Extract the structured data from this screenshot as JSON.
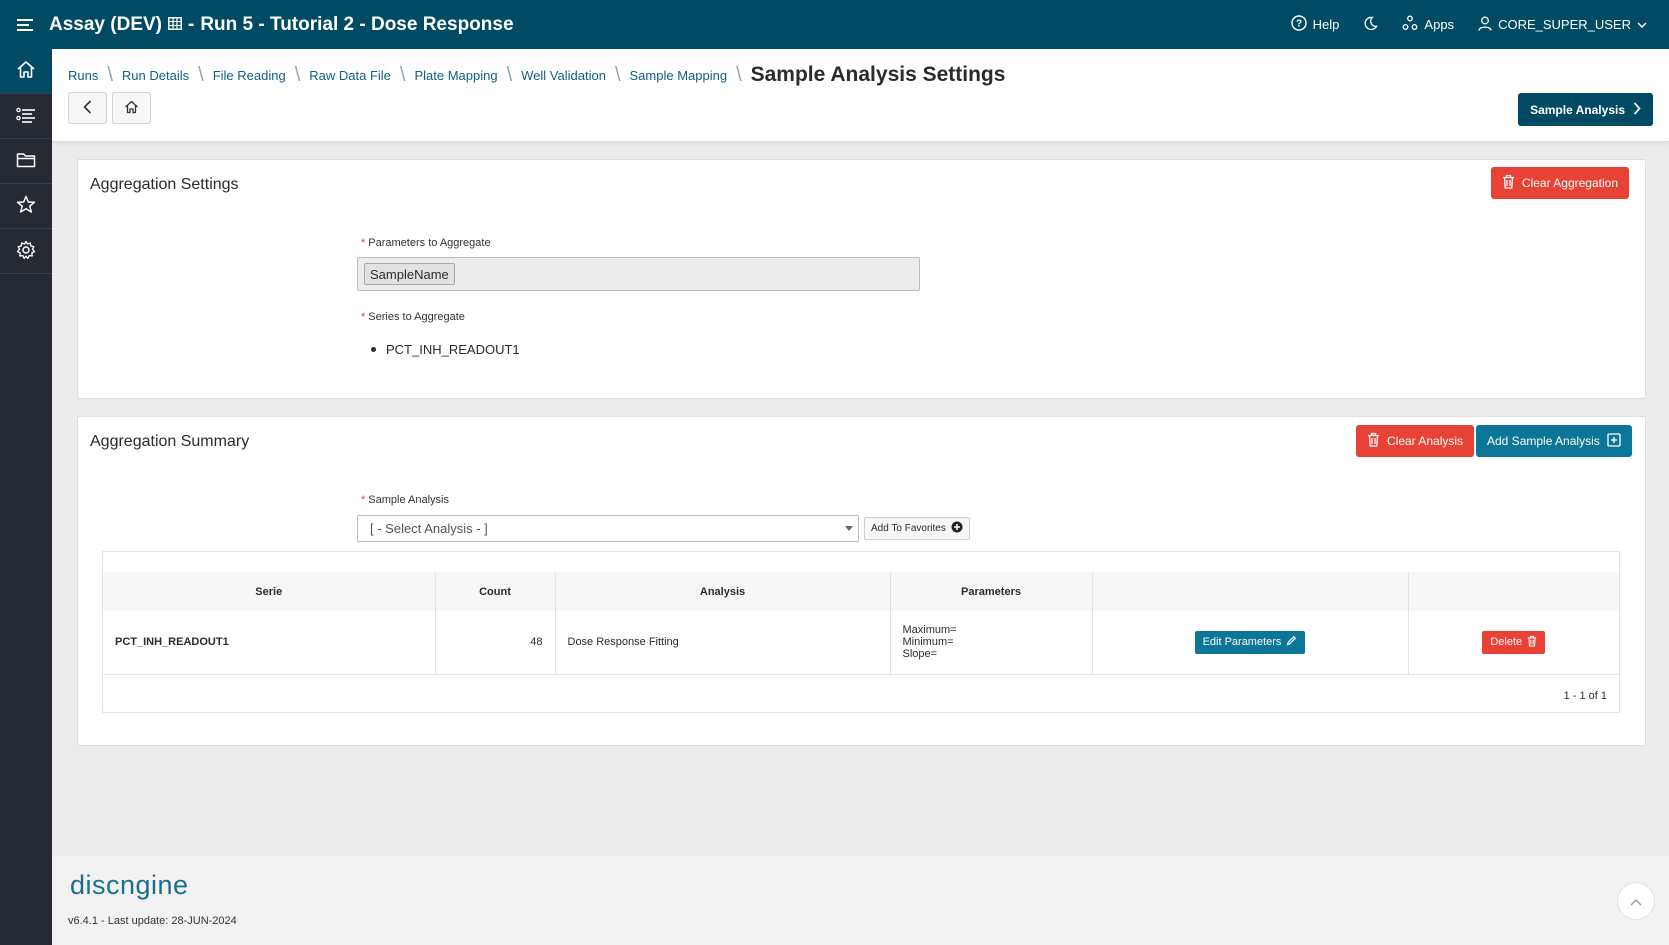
{
  "header": {
    "app_name": "Assay (DEV)",
    "page_title": "Run 5 - Tutorial 2 - Dose Response",
    "help": "Help",
    "apps": "Apps",
    "user": "CORE_SUPER_USER"
  },
  "breadcrumb": {
    "items": [
      "Runs",
      "Run Details",
      "File Reading",
      "Raw Data File",
      "Plate Mapping",
      "Well Validation",
      "Sample Mapping"
    ],
    "current": "Sample Analysis Settings"
  },
  "next_button": "Sample Analysis",
  "aggregation_settings": {
    "title": "Aggregation Settings",
    "clear_button": "Clear Aggregation",
    "params_label": "Parameters to Aggregate",
    "params_value": "SampleName",
    "series_label": "Series to Aggregate",
    "series": [
      "PCT_INH_READOUT1"
    ]
  },
  "aggregation_summary": {
    "title": "Aggregation Summary",
    "clear_button": "Clear Analysis",
    "add_button": "Add Sample Analysis",
    "analysis_label": "Sample Analysis",
    "analysis_placeholder": "[ - Select Analysis - ]",
    "favorites_button": "Add To Favorites",
    "columns": [
      "Serie",
      "Count",
      "Analysis",
      "Parameters",
      "",
      ""
    ],
    "rows": [
      {
        "serie": "PCT_INH_READOUT1",
        "count": "48",
        "analysis": "Dose Response Fitting",
        "parameters": [
          "Maximum=",
          "Minimum=",
          "Slope="
        ],
        "edit_label": "Edit Parameters",
        "delete_label": "Delete"
      }
    ],
    "pagination": "1 - 1 of 1"
  },
  "footer": {
    "logo": "discngine",
    "version": "v6.4.1 - Last update: 28-JUN-2024"
  },
  "colors": {
    "header": "#004a64",
    "sidenav": "#262b33",
    "danger": "#e84135",
    "teal": "#0b7697",
    "link": "#0f5f86"
  }
}
